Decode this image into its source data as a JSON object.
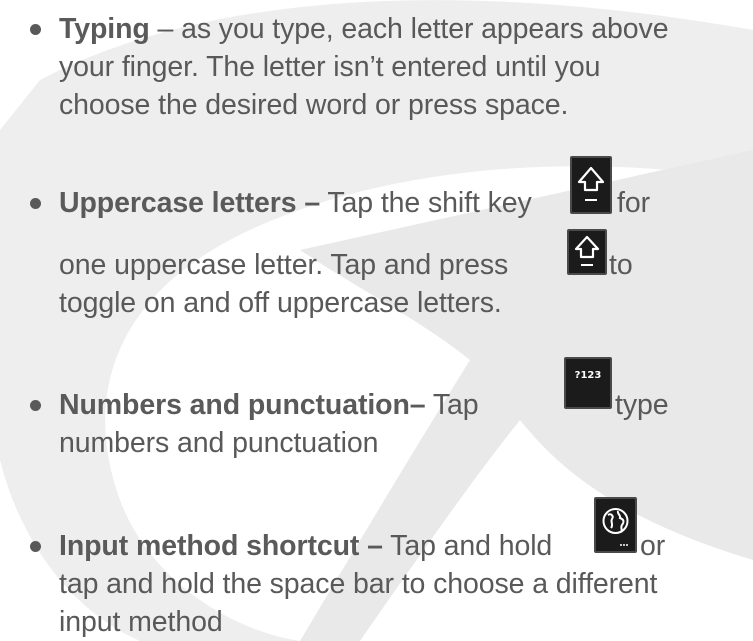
{
  "items": [
    {
      "bold": "Typing",
      "line1_rest": " – as you type, each letter appears above",
      "line2": "your finger. The letter isn’t entered until you",
      "line3": "choose the desired word or press space."
    },
    {
      "bold": "Uppercase letters –",
      "line1_before_icon": " Tap the shift key",
      "line1_after_icon": " for",
      "line2_before_icon": "one uppercase letter. Tap and press",
      "line2_after_icon": " to",
      "line3": "toggle on and off uppercase letters."
    },
    {
      "bold": "Numbers and punctuation–",
      "line1_before_icon": " Tap",
      "line1_after_icon": " type",
      "line2": "numbers and punctuation"
    },
    {
      "bold": "Input method shortcut –",
      "line1_before_icon": " Tap and hold",
      "line1_after_icon": " or",
      "line2": "tap and hold the space bar to choose a different",
      "line3": "input method"
    }
  ],
  "keys": {
    "numbers_key_label": "?123",
    "shift_icon": "shift-arrow-icon",
    "input_method_icon": "globe-icon"
  },
  "colors": {
    "text": "#595959",
    "key_background": "#1b1b1b",
    "watermark": "#e6e6e6"
  }
}
